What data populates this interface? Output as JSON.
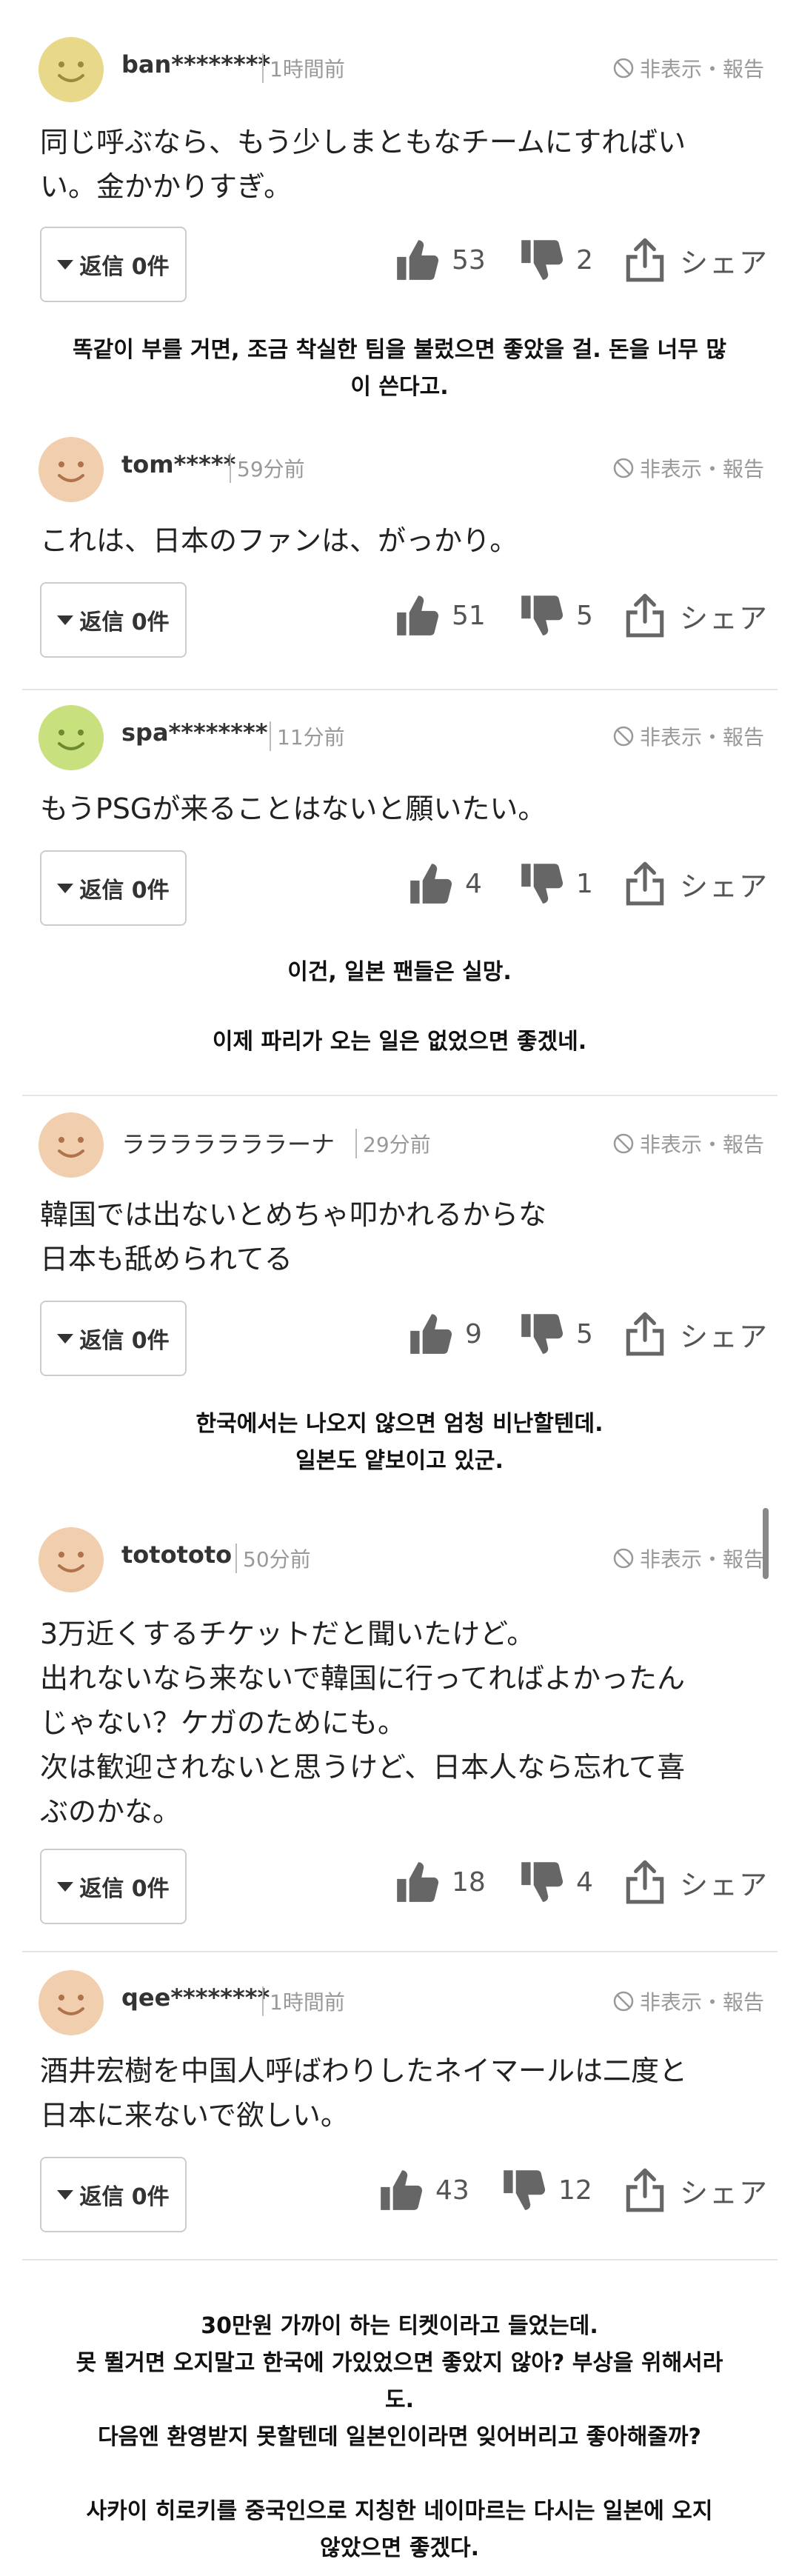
{
  "ui": {
    "hide_report": "非表示・報告",
    "share": "シェア"
  },
  "colors": {
    "avatar_yellow": "#e8d98a",
    "avatar_orange": "#f1cfae",
    "avatar_green": "#c9e07e",
    "icon_gray": "#666666"
  },
  "comments": [
    {
      "user": "ban********",
      "time": "1時間前",
      "text_lines": [
        "同じ呼ぶなら、もう少しまともなチームにすればい",
        "い。金かかりすぎ。"
      ],
      "reply": "返信 0件",
      "likes": "53",
      "dislikes": "2",
      "avatar_color": "avatar_yellow"
    },
    {
      "user": "tom*****",
      "time": "59分前",
      "text_lines": [
        "これは、日本のファンは、がっかり。"
      ],
      "reply": "返信 0件",
      "likes": "51",
      "dislikes": "5",
      "avatar_color": "avatar_orange"
    },
    {
      "user": "spa********",
      "time": "11分前",
      "text_lines": [
        "もうPSGが来ることはないと願いたい。"
      ],
      "reply": "返信 0件",
      "likes": "4",
      "dislikes": "1",
      "avatar_color": "avatar_green"
    },
    {
      "user": "ラララララララーナ",
      "time": "29分前",
      "text_lines": [
        "韓国では出ないとめちゃ叩かれるからな",
        "日本も舐められてる"
      ],
      "reply": "返信 0件",
      "likes": "9",
      "dislikes": "5",
      "avatar_color": "avatar_orange"
    },
    {
      "user": "totototo",
      "time": "50分前",
      "text_lines": [
        "3万近くするチケットだと聞いたけど。",
        "出れないなら来ないで韓国に行ってればよかったん",
        "じゃない？ケガのためにも。",
        "次は歓迎されないと思うけど、日本人なら忘れて喜",
        "ぶのかな。"
      ],
      "reply": "返信 0件",
      "likes": "18",
      "dislikes": "4",
      "avatar_color": "avatar_orange"
    },
    {
      "user": "qee********",
      "time": "1時間前",
      "text_lines": [
        "酒井宏樹を中国人呼ばわりしたネイマールは二度と",
        "日本に来ないで欲しい。"
      ],
      "reply": "返信 0件",
      "likes": "43",
      "dislikes": "12",
      "avatar_color": "avatar_orange"
    }
  ],
  "translations": {
    "t1": [
      "똑같이 부를 거면, 조금 착실한 팀을 불렀으면 좋았을 걸. 돈을 너무 많",
      "이 쓴다고."
    ],
    "t3a": [
      "이건, 일본 팬들은 실망."
    ],
    "t3b": [
      "이제 파리가 오는 일은 없었으면 좋겠네."
    ],
    "t4": [
      "한국에서는 나오지 않으면 엄청 비난할텐데.",
      "일본도 얕보이고 있군."
    ],
    "t6": [
      "30만원 가까이 하는 티켓이라고 들었는데.",
      "못 뛸거면 오지말고 한국에 가있었으면 좋았지 않아? 부상을 위해서라",
      "도.",
      "다음엔 환영받지 못할텐데 일본인이라면 잊어버리고 좋아해줄까?",
      "",
      "사카이 히로키를 중국인으로 지칭한 네이마르는 다시는 일본에 오지",
      "않았으면 좋겠다."
    ]
  }
}
